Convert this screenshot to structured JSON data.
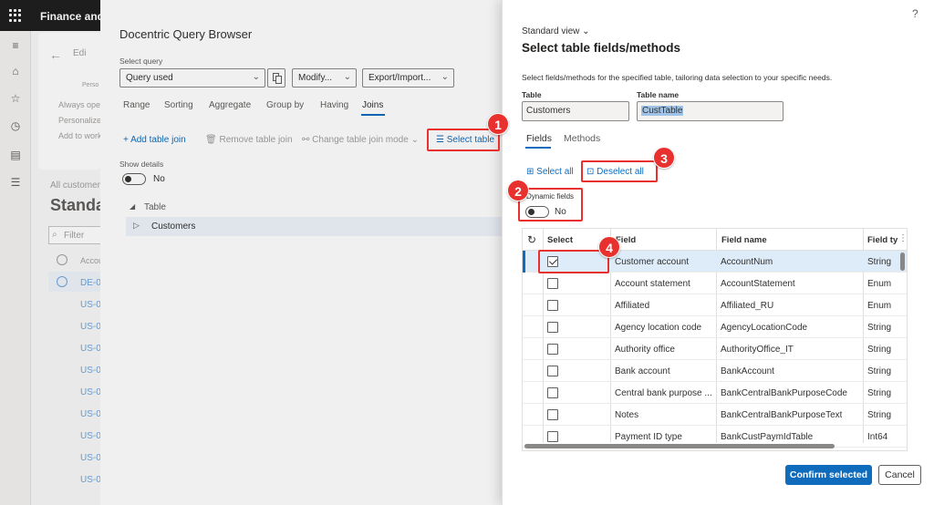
{
  "app": {
    "title": "Finance and"
  },
  "background": {
    "edit_label": "Edi",
    "person_label": "Perso",
    "options": [
      "Always ope",
      "Personalize",
      "Add to work"
    ],
    "all_customers": "All customer",
    "standard": "Standa",
    "filter_placeholder": "Filter",
    "column": "Accou",
    "rows": [
      "DE-0",
      "US-0",
      "US-0",
      "US-0",
      "US-0",
      "US-0",
      "US-0",
      "US-0",
      "US-0"
    ]
  },
  "query_browser": {
    "title": "Docentric Query Browser",
    "select_query_label": "Select query",
    "select_query_value": "Query used",
    "modify_label": "Modify...",
    "export_import_label": "Export/Import...",
    "tabs": [
      "Range",
      "Sorting",
      "Aggregate",
      "Group by",
      "Having",
      "Joins"
    ],
    "active_tab": "Joins",
    "toolbar": {
      "add_join": "Add table join",
      "remove_join": "Remove table join",
      "change_mode": "Change table join mode",
      "select_table": "Select table"
    },
    "show_details_label": "Show details",
    "show_details_value": "No",
    "tree_header": "Table",
    "tree_item": "Customers"
  },
  "dialog": {
    "help": "?",
    "view_name": "Standard view",
    "title": "Select table fields/methods",
    "description": "Select fields/methods for the specified table, tailoring data selection to your specific needs.",
    "table_label": "Table",
    "table_value": "Customers",
    "table_name_label": "Table name",
    "table_name_value": "CustTable",
    "tabs": [
      "Fields",
      "Methods"
    ],
    "select_all": "Select all",
    "deselect_all": "Deselect all",
    "dynamic_fields_label": "Dynamic fields",
    "dynamic_fields_value": "No",
    "grid": {
      "headers": {
        "select": "Select",
        "field": "Field",
        "field_name": "Field name",
        "field_type": "Field typ"
      },
      "rows": [
        {
          "field": "Customer account",
          "name": "AccountNum",
          "type": "String",
          "checked": true
        },
        {
          "field": "Account statement",
          "name": "AccountStatement",
          "type": "Enum",
          "checked": false
        },
        {
          "field": "Affiliated",
          "name": "Affiliated_RU",
          "type": "Enum",
          "checked": false
        },
        {
          "field": "Agency location code",
          "name": "AgencyLocationCode",
          "type": "String",
          "checked": false
        },
        {
          "field": "Authority office",
          "name": "AuthorityOffice_IT",
          "type": "String",
          "checked": false
        },
        {
          "field": "Bank account",
          "name": "BankAccount",
          "type": "String",
          "checked": false
        },
        {
          "field": "Central bank purpose ...",
          "name": "BankCentralBankPurposeCode",
          "type": "String",
          "checked": false
        },
        {
          "field": "Notes",
          "name": "BankCentralBankPurposeText",
          "type": "String",
          "checked": false
        },
        {
          "field": "Payment ID type",
          "name": "BankCustPaymIdTable",
          "type": "Int64",
          "checked": false
        }
      ]
    },
    "confirm_label": "Confirm selected",
    "cancel_label": "Cancel"
  },
  "callouts": [
    "1",
    "2",
    "3",
    "4"
  ],
  "colors": {
    "accent": "#0f6cbd",
    "callout": "#e8312f"
  }
}
